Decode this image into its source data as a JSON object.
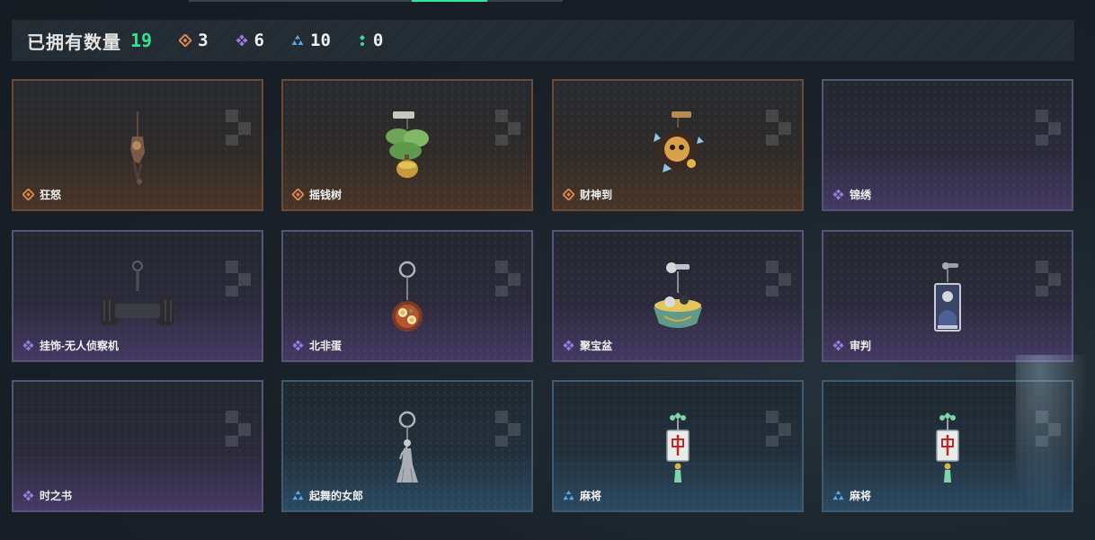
{
  "header": {
    "owned_label": "已拥有数量",
    "owned_total": "19",
    "rarity_counts": [
      {
        "tier": "gold",
        "icon": "orange-diamond-rarity-icon",
        "color": "#e0874e",
        "count": "3"
      },
      {
        "tier": "purple",
        "icon": "purple-diamond-rarity-icon",
        "color": "#9b7be0",
        "count": "6"
      },
      {
        "tier": "blue",
        "icon": "blue-triangle-rarity-icon",
        "color": "#5aa7e6",
        "count": "10"
      },
      {
        "tier": "green",
        "icon": "green-dots-rarity-icon",
        "color": "#3fd9a0",
        "count": "0"
      }
    ]
  },
  "items": [
    {
      "name": "狂怒",
      "rarity": "gold",
      "icon": "rage-charm-icon"
    },
    {
      "name": "摇钱树",
      "rarity": "gold",
      "icon": "money-tree-charm-icon"
    },
    {
      "name": "财神到",
      "rarity": "gold",
      "icon": "god-of-wealth-charm-icon"
    },
    {
      "name": "锦绣",
      "rarity": "purple",
      "icon": ""
    },
    {
      "name": "挂饰-无人侦察机",
      "rarity": "purple",
      "icon": "drone-charm-icon"
    },
    {
      "name": "北非蛋",
      "rarity": "purple",
      "icon": "shakshuka-charm-icon"
    },
    {
      "name": "聚宝盆",
      "rarity": "purple",
      "icon": "treasure-bowl-charm-icon"
    },
    {
      "name": "审判",
      "rarity": "purple",
      "icon": "judgement-card-charm-icon"
    },
    {
      "name": "时之书",
      "rarity": "purple",
      "icon": ""
    },
    {
      "name": "起舞的女郎",
      "rarity": "blue",
      "icon": "dancing-lady-charm-icon"
    },
    {
      "name": "麻将",
      "rarity": "blue",
      "icon": "mahjong-tile-charm-icon"
    },
    {
      "name": "麻将",
      "rarity": "blue",
      "icon": "mahjong-tile-charm-icon"
    }
  ],
  "colors": {
    "accent_green": "#2fe38f",
    "gold_tier": "#e0874e",
    "purple_tier": "#9b7be0",
    "blue_tier": "#5aa7e6"
  }
}
